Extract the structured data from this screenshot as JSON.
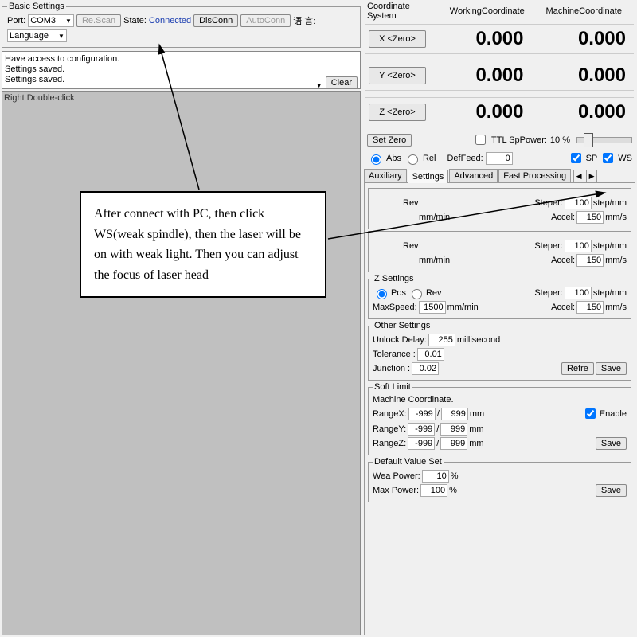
{
  "basic": {
    "title": "Basic Settings",
    "port_label": "Port:",
    "port_value": "COM3",
    "rescan": "Re.Scan",
    "state_label": "State:",
    "state_value": "Connected",
    "disconn": "DisConn",
    "autoconn": "AutoConn",
    "lang_zh": "语  言:",
    "lang_en": "Language",
    "log1": "Have access to configuration.",
    "log2": "Settings saved.",
    "log3": "Settings saved.",
    "clear": "Clear",
    "canvas_hint": "Right Double-click"
  },
  "coord": {
    "sys": "Coordinate System",
    "working": "WorkingCoordinate",
    "machine": "MachineCoordinate",
    "x": "X <Zero>",
    "y": "Y <Zero>",
    "z": "Z <Zero>",
    "val": "0.000",
    "set_zero": "Set Zero",
    "ttl_label": "TTL SpPower:",
    "ttl_val": "10 %",
    "abs": "Abs",
    "rel": "Rel",
    "deffeed": "DefFeed:",
    "deffeed_val": "0",
    "sp": "SP",
    "ws": "WS"
  },
  "tabs": {
    "auxiliary": "Auxiliary",
    "settings": "Settings",
    "advanced": "Advanced",
    "fast": "Fast Processing"
  },
  "axisx": {
    "rev": "Rev",
    "speed_unit": " mm/min",
    "accel": "Accel:",
    "accel_val": "150",
    "accel_unit": " mm/s",
    "steper": "Steper:",
    "steper_val": "100",
    "steper_unit": " step/mm"
  },
  "zset": {
    "legend": "Z Settings",
    "pos": "Pos",
    "rev": "Rev",
    "maxspeed": "MaxSpeed:",
    "maxspeed_val": "1500",
    "speed_unit": " mm/min",
    "steper": "Steper:",
    "steper_val": "100",
    "steper_unit": " step/mm",
    "accel": "Accel:",
    "accel_val": "150",
    "accel_unit": " mm/s"
  },
  "other": {
    "legend": "Other Settings",
    "unlock": "Unlock Delay:",
    "unlock_val": "255",
    "unlock_unit": " millisecond",
    "tol": "Tolerance :",
    "tol_val": "0.01",
    "junc": "Junction :",
    "junc_val": "0.02",
    "refresh": "Refre",
    "save": "Save"
  },
  "soft": {
    "legend": "Soft Limit",
    "mc": "Machine Coordinate.",
    "rx": "RangeX:",
    "ry": "RangeY:",
    "rz": "RangeZ:",
    "lo": "-999",
    "hi": "999",
    "mm": "mm",
    "enable": "Enable",
    "save": "Save"
  },
  "default": {
    "legend": "Default Value Set",
    "wea": "Wea Power:",
    "wea_val": "10",
    "max": "Max Power:",
    "max_val": "100",
    "pct": " %",
    "save": "Save"
  },
  "annotation": "After connect with PC, then click WS(weak spindle), then the laser will be on with weak light. Then you can adjust the focus of laser head"
}
